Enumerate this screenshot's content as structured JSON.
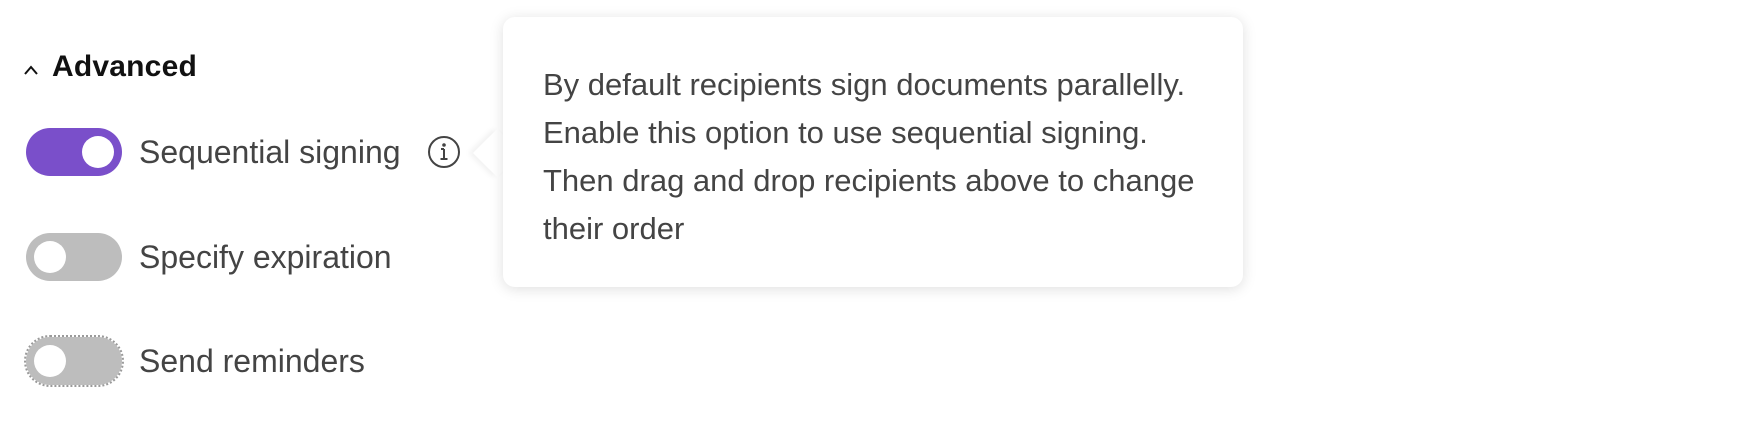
{
  "section": {
    "title": "Advanced",
    "expanded": true
  },
  "options": [
    {
      "label": "Sequential signing",
      "enabled": true
    },
    {
      "label": "Specify expiration",
      "enabled": false
    },
    {
      "label": "Send reminders",
      "enabled": false
    }
  ],
  "tooltip": {
    "text": "By default recipients sign documents parallelly. Enable this option to use sequential signing. Then drag and drop recipients above to change their order"
  },
  "colors": {
    "toggle_on": "#7a4fca",
    "toggle_off": "#bdbdbd"
  },
  "icons": {
    "section_toggle": "chevron-up-icon",
    "info": "info-icon"
  }
}
